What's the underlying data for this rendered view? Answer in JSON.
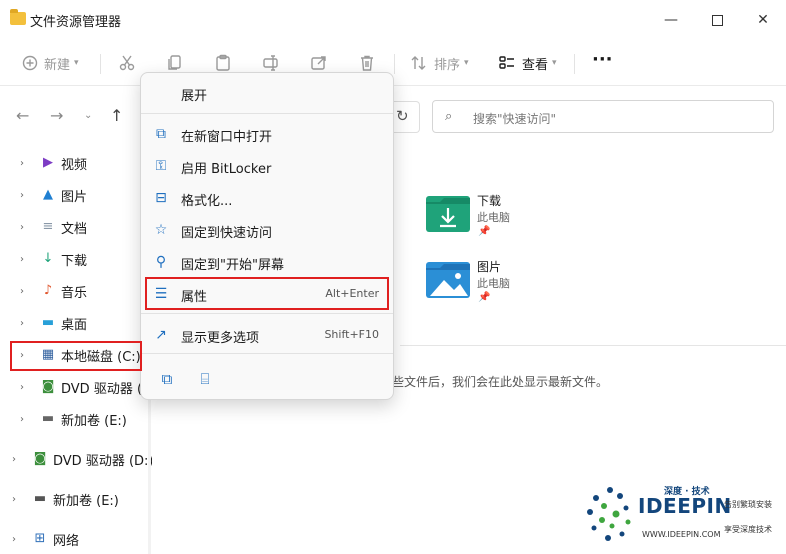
{
  "window": {
    "title": "文件资源管理器",
    "minimize_glyph": "—",
    "close_glyph": "✕"
  },
  "toolbar": {
    "new_label": "新建",
    "sort_label": "排序",
    "view_label": "查看",
    "more_glyph": "···"
  },
  "search": {
    "placeholder": "搜索\"快速访问\""
  },
  "sidebar": {
    "items": [
      {
        "label": "视频",
        "icon": "video-icon"
      },
      {
        "label": "图片",
        "icon": "pictures-icon"
      },
      {
        "label": "文档",
        "icon": "documents-icon"
      },
      {
        "label": "下载",
        "icon": "download-icon"
      },
      {
        "label": "音乐",
        "icon": "music-icon"
      },
      {
        "label": "桌面",
        "icon": "desktop-icon"
      },
      {
        "label": "本地磁盘 (C:)",
        "icon": "local-disk-icon"
      },
      {
        "label": "DVD 驱动器 (D:)",
        "icon": "dvd-drive-icon"
      },
      {
        "label": "新加卷 (E:)",
        "icon": "drive-icon"
      },
      {
        "label": "DVD 驱动器 (D:)",
        "icon": "dvd-drive-icon"
      },
      {
        "label": "新加卷 (E:)",
        "icon": "drive-icon"
      },
      {
        "label": "网络",
        "icon": "network-icon"
      }
    ]
  },
  "main": {
    "folders": [
      {
        "name": "下载",
        "location": "此电脑",
        "icon": "downloads-folder-icon"
      },
      {
        "name": "图片",
        "location": "此电脑",
        "icon": "pictures-folder-icon"
      }
    ],
    "recent_text": "些文件后，我们会在此处显示最新文件。"
  },
  "context_menu": {
    "items": [
      {
        "label": "展开",
        "shortcut": "",
        "icon": ""
      },
      {
        "label": "在新窗口中打开",
        "shortcut": "",
        "icon": "open-new-window-icon"
      },
      {
        "label": "启用 BitLocker",
        "shortcut": "",
        "icon": "bitlocker-icon"
      },
      {
        "label": "格式化...",
        "shortcut": "",
        "icon": "format-icon"
      },
      {
        "label": "固定到快速访问",
        "shortcut": "",
        "icon": "pin-star-icon"
      },
      {
        "label": "固定到\"开始\"屏幕",
        "shortcut": "",
        "icon": "pin-start-icon"
      },
      {
        "label": "属性",
        "shortcut": "Alt+Enter",
        "icon": "properties-icon"
      },
      {
        "label": "显示更多选项",
        "shortcut": "Shift+F10",
        "icon": "more-options-icon"
      }
    ]
  },
  "watermark": {
    "brand": "IDEEPIN",
    "tagline": "深度 · 技术",
    "url": "WWW.IDEEPIN.COM",
    "side_1": "告别繁琐安装",
    "side_2": "享受深度技术"
  },
  "colors": {
    "accent": "#1f6fbf",
    "highlight": "#e02020",
    "watermark": "#13467c"
  }
}
